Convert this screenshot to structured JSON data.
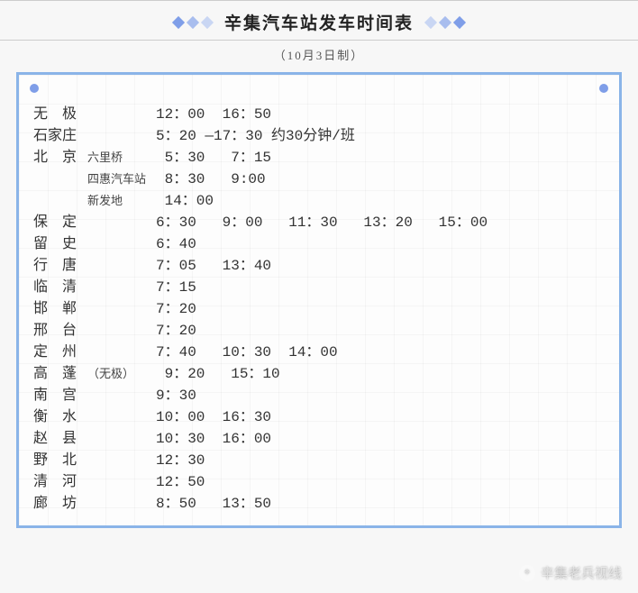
{
  "title": "辛集汽车站发车时间表",
  "subtitle": "（10月3日制）",
  "rows": [
    {
      "dest": "无　极",
      "sub": "",
      "times": "12：00  16：50"
    },
    {
      "dest": "石家庄",
      "sub": "",
      "times": "5：20 —17：30 约30分钟/班"
    },
    {
      "dest": "北　京",
      "sub": "六里桥",
      "times": " 5：30   7：15"
    },
    {
      "dest": "",
      "sub": "四惠汽车站",
      "times": " 8：30   9:00"
    },
    {
      "dest": "",
      "sub": "新发地",
      "times": " 14：00"
    },
    {
      "dest": "保　定",
      "sub": "",
      "times": "6：30   9：00   11：30   13：20   15：00"
    },
    {
      "dest": "留　史",
      "sub": "",
      "times": "6：40"
    },
    {
      "dest": "行　唐",
      "sub": "",
      "times": "7：05   13：40"
    },
    {
      "dest": "临　清",
      "sub": "",
      "times": "7：15"
    },
    {
      "dest": "邯　郸",
      "sub": "",
      "times": "7：20"
    },
    {
      "dest": "邢　台",
      "sub": "",
      "times": "7：20"
    },
    {
      "dest": "定　州",
      "sub": "",
      "times": "7：40   10：30  14：00"
    },
    {
      "dest": "高　蓬",
      "sub": "（无极）",
      "times": " 9：20   15：10"
    },
    {
      "dest": "南　宫",
      "sub": "",
      "times": "9：30"
    },
    {
      "dest": "衡　水",
      "sub": "",
      "times": "10：00  16：30"
    },
    {
      "dest": "赵　县",
      "sub": "",
      "times": "10：30  16：00"
    },
    {
      "dest": "野　北",
      "sub": "",
      "times": "12：30"
    },
    {
      "dest": "清　河",
      "sub": "",
      "times": "12：50"
    },
    {
      "dest": "廊　坊",
      "sub": "",
      "times": "8：50   13：50"
    }
  ],
  "watermark": "辛集老兵视线"
}
